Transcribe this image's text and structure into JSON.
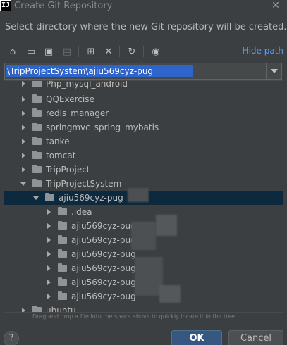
{
  "window": {
    "app_icon": "IJ",
    "title": "Create Git Repository",
    "close_label": "✕"
  },
  "description": "Select directory where the new Git repository will be created.",
  "toolbar": {
    "buttons": [
      {
        "name": "home-icon",
        "glyph": "⌂"
      },
      {
        "name": "desktop-icon",
        "glyph": "▭"
      },
      {
        "name": "project-icon",
        "glyph": "▣"
      },
      {
        "name": "module-icon",
        "glyph": "▤"
      },
      {
        "name": "new-folder-icon",
        "glyph": "⊞"
      },
      {
        "name": "delete-icon",
        "glyph": "✕"
      },
      {
        "name": "refresh-icon",
        "glyph": "↻"
      },
      {
        "name": "show-hidden-icon",
        "glyph": "◉"
      }
    ],
    "hide_path_label": "Hide path"
  },
  "path": {
    "value": "\\TripProjectSystem\\ajiu569cyz-pug"
  },
  "tree": {
    "items": [
      {
        "label": "Php_mysql_android",
        "level": 1,
        "expanded": false,
        "selected": false
      },
      {
        "label": "QQExercise",
        "level": 1,
        "expanded": false,
        "selected": false
      },
      {
        "label": "redis_manager",
        "level": 1,
        "expanded": false,
        "selected": false
      },
      {
        "label": "springmvc_spring_mybatis",
        "level": 1,
        "expanded": false,
        "selected": false
      },
      {
        "label": "tanke",
        "level": 1,
        "expanded": false,
        "selected": false
      },
      {
        "label": "tomcat",
        "level": 1,
        "expanded": false,
        "selected": false
      },
      {
        "label": "TripProject",
        "level": 1,
        "expanded": false,
        "selected": false
      },
      {
        "label": "TripProjectSystem",
        "level": 1,
        "expanded": true,
        "selected": false
      },
      {
        "label": "ajiu569cyz-pug",
        "level": 2,
        "expanded": true,
        "selected": true
      },
      {
        "label": ".idea",
        "level": 3,
        "expanded": false,
        "selected": false
      },
      {
        "label": "ajiu569cyz-pug",
        "level": 3,
        "expanded": false,
        "selected": false
      },
      {
        "label": "ajiu569cyz-pug",
        "level": 3,
        "expanded": false,
        "selected": false
      },
      {
        "label": "ajiu569cyz-pug",
        "level": 3,
        "expanded": false,
        "selected": false
      },
      {
        "label": "ajiu569cyz-pug",
        "level": 3,
        "expanded": false,
        "selected": false
      },
      {
        "label": "ajiu569cyz-pug",
        "level": 3,
        "expanded": false,
        "selected": false
      },
      {
        "label": "ajiu569cyz-pug",
        "level": 3,
        "expanded": false,
        "selected": false
      },
      {
        "label": "ubuntu",
        "level": 1,
        "expanded": false,
        "selected": false
      }
    ]
  },
  "hint": "Drag and drop a file into the space above to quickly locate it in the tree",
  "buttons": {
    "help": "?",
    "ok": "OK",
    "cancel": "Cancel"
  }
}
